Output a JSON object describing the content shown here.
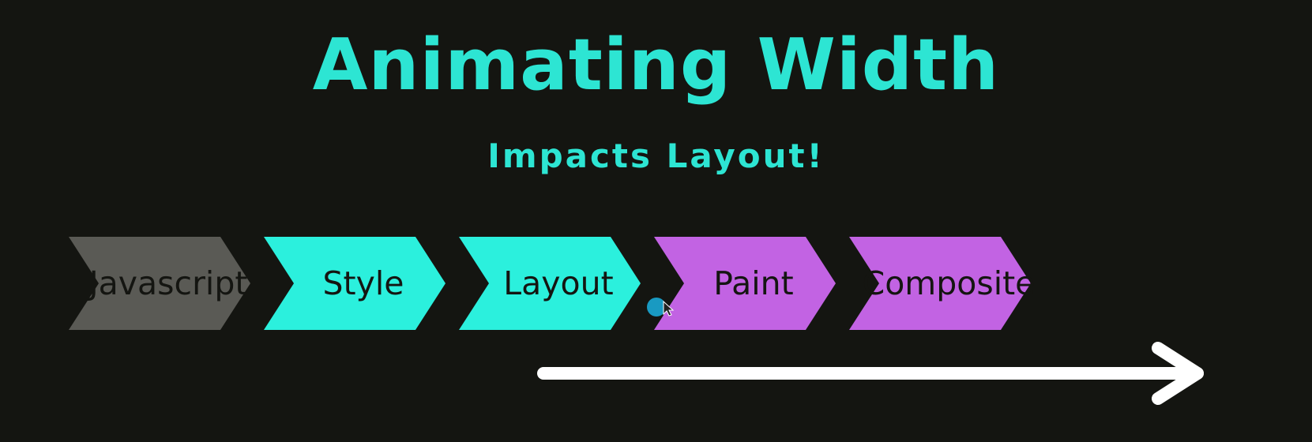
{
  "title": "Animating Width",
  "subtitle": "Impacts Layout!",
  "stages": [
    {
      "label": "Javascript",
      "color": "#5a5a55"
    },
    {
      "label": "Style",
      "color": "#2bf0dd"
    },
    {
      "label": "Layout",
      "color": "#2bf0dd"
    },
    {
      "label": "Paint",
      "color": "#c263e3"
    },
    {
      "label": "Composite",
      "color": "#c263e3"
    }
  ],
  "arrow_color": "#ffffff",
  "cursor_color": "#1aa9d6",
  "background": "#141511"
}
